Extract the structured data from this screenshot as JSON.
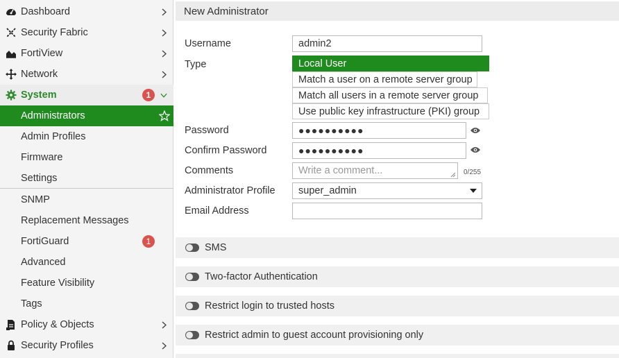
{
  "sidebar": {
    "items": [
      {
        "label": "Dashboard"
      },
      {
        "label": "Security Fabric"
      },
      {
        "label": "FortiView"
      },
      {
        "label": "Network"
      },
      {
        "label": "System",
        "badge": "1"
      },
      {
        "label": "Policy & Objects"
      },
      {
        "label": "Security Profiles"
      }
    ],
    "system_sub": [
      {
        "label": "Administrators"
      },
      {
        "label": "Admin Profiles"
      },
      {
        "label": "Firmware"
      },
      {
        "label": "Settings"
      },
      {
        "label": "SNMP"
      },
      {
        "label": "Replacement Messages"
      },
      {
        "label": "FortiGuard",
        "badge": "1"
      },
      {
        "label": "Advanced"
      },
      {
        "label": "Feature Visibility"
      },
      {
        "label": "Tags"
      }
    ]
  },
  "main": {
    "title": "New Administrator",
    "username_label": "Username",
    "username_value": "admin2",
    "type_label": "Type",
    "type_options": [
      "Local User",
      "Match a user on a remote server group",
      "Match all users in a remote server group",
      "Use public key infrastructure (PKI) group"
    ],
    "type_selected": "Local User",
    "password_label": "Password",
    "password_mask": "●●●●●●●●●●",
    "confirm_label": "Confirm Password",
    "confirm_mask": "●●●●●●●●●●",
    "comments_label": "Comments",
    "comments_placeholder": "Write a comment...",
    "comments_count": "0/255",
    "profile_label": "Administrator Profile",
    "profile_value": "super_admin",
    "email_label": "Email Address",
    "email_value": "",
    "sections": [
      {
        "label": "SMS"
      },
      {
        "label": "Two-factor Authentication"
      },
      {
        "label": "Restrict login to trusted hosts"
      },
      {
        "label": "Restrict admin to guest account provisioning only"
      }
    ]
  },
  "colors": {
    "accent": "#1f8b1f",
    "badge": "#d9534f",
    "sidebar_bg": "#f4f4f4"
  },
  "icons": {
    "dashboard": "dashboard-icon",
    "security_fabric": "security-fabric-icon",
    "fortiview": "fortiview-icon",
    "network": "network-icon",
    "system": "gear-icon",
    "policy": "policy-icon",
    "security_profiles": "lock-icon"
  }
}
